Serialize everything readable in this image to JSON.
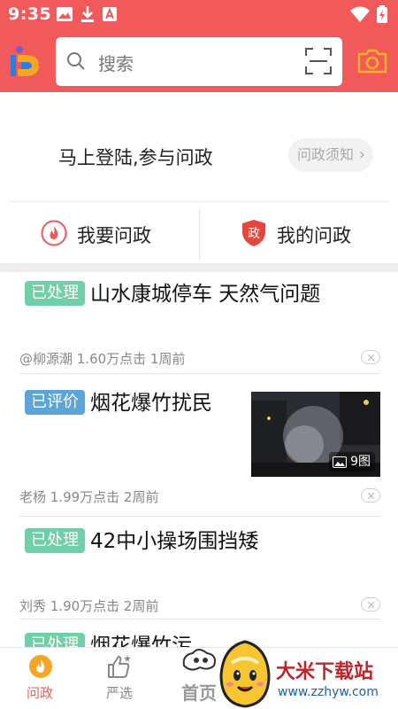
{
  "status_bar": {
    "time": "9:35"
  },
  "search": {
    "placeholder": "搜索"
  },
  "login": {
    "prompt": "马上登陆,参与问政",
    "notice_label": "问政须知",
    "notice_chevron": "›"
  },
  "actions": {
    "ask_label": "我要问政",
    "mine_label": "我的问政",
    "mine_icon_char": "政"
  },
  "feed": [
    {
      "badge": "已处理",
      "badge_color": "#6fcfa6",
      "title": "山水康城停车 天然气问题",
      "meta": "@柳源潮 1.60万点击 1周前"
    },
    {
      "badge": "已评价",
      "badge_color": "#5da4d8",
      "title": "烟花爆竹扰民",
      "meta": "老杨 1.99万点击 2周前",
      "image_count": "9图"
    },
    {
      "badge": "已处理",
      "badge_color": "#6fcfa6",
      "title": "42中小操场围挡矮",
      "meta": "刘秀 1.90万点击 2周前"
    },
    {
      "badge": "已处理",
      "badge_color": "#6fcfa6",
      "title": "烟花爆竹污..."
    }
  ],
  "tabs": {
    "wenzheng": "问政",
    "yanxuan": "严选",
    "home": "首页"
  },
  "watermark": {
    "name": "大米下载站",
    "url": "www.zzhyw.com"
  },
  "colors": {
    "brand": "#f2595b",
    "camera": "#f5b324"
  }
}
